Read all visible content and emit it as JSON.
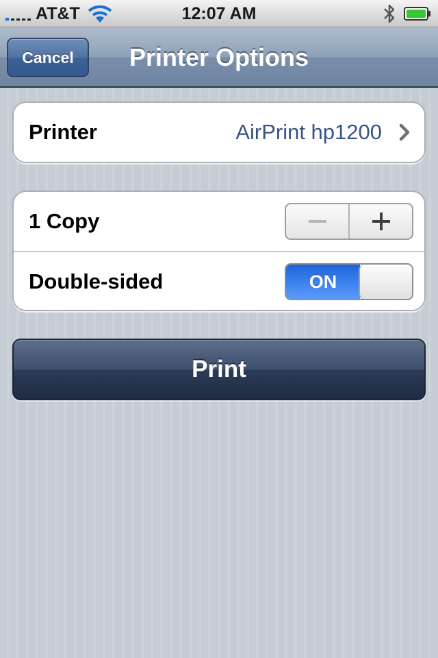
{
  "status_bar": {
    "carrier": "AT&T",
    "time": "12:07 AM",
    "icons": [
      "signal-icon",
      "wifi-icon",
      "bluetooth-icon",
      "battery-icon"
    ]
  },
  "nav_bar": {
    "cancel_label": "Cancel",
    "title": "Printer Options"
  },
  "printer_row": {
    "label": "Printer",
    "value": "AirPrint hp1200"
  },
  "copies_row": {
    "label": "1 Copy"
  },
  "double_sided_row": {
    "label": "Double-sided",
    "toggle_label": "ON"
  },
  "print_button": {
    "label": "Print"
  },
  "colors": {
    "nav_bar": "#7b8faa",
    "print_button": "#2c3b56",
    "toggle_on": "#3b80ee",
    "printer_value": "#385487",
    "battery": "#35c92f"
  }
}
